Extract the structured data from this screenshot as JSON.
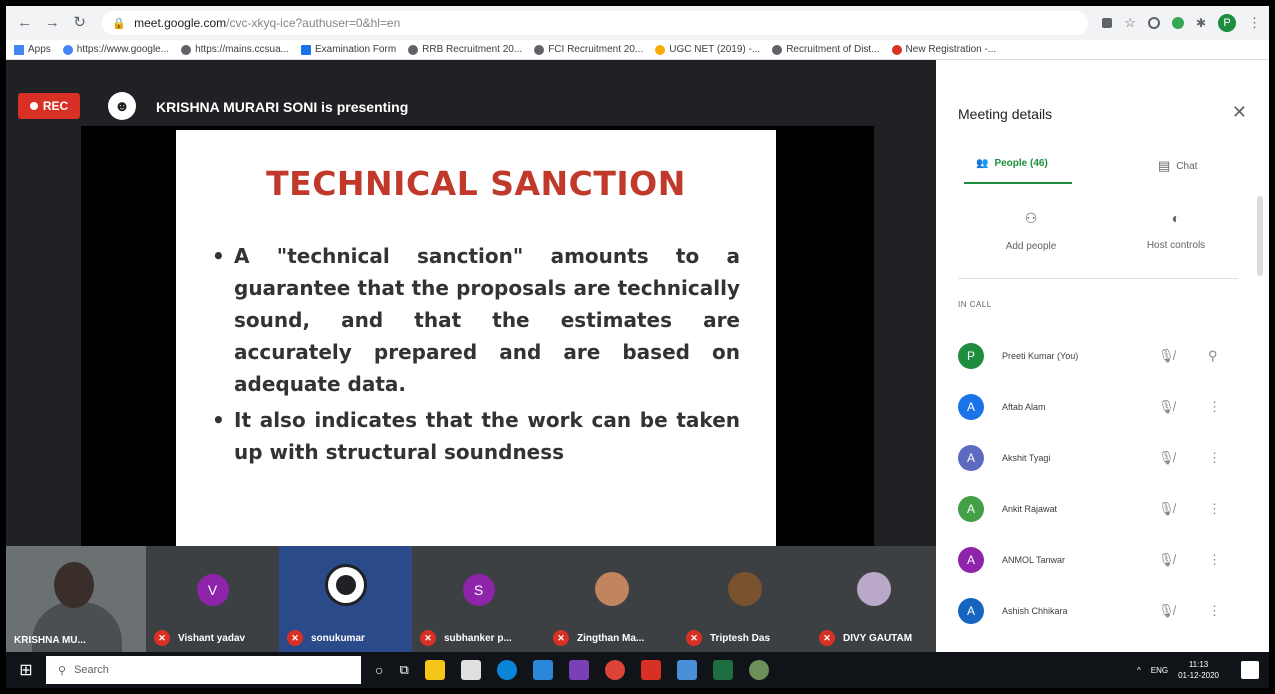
{
  "browser": {
    "url_host": "meet.google.com",
    "url_path": "/cvc-xkyq-ice?authuser=0&hl=en",
    "bookmarks": [
      "Apps",
      "https://www.google...",
      "https://mains.ccsua...",
      "Examination Form",
      "RRB Recruitment 20...",
      "FCI Recruitment 20...",
      "UGC NET (2019) -...",
      "Recruitment of Dist...",
      "New Registration -..."
    ],
    "profile_initial": "P"
  },
  "meet": {
    "rec_label": "REC",
    "presenter_text": "KRISHNA MURARI SONI is presenting",
    "slide": {
      "title": "TECHNICAL SANCTION",
      "bullets": [
        "A \"technical sanction\" amounts to a guarantee that the proposals are technically sound, and that the estimates are accurately prepared and are based on adequate data.",
        "It also indicates that the work can be taken up with structural soundness"
      ]
    },
    "tiles": [
      {
        "name": "KRISHNA MU...",
        "initial": "",
        "color": ""
      },
      {
        "name": "Vishant yadav",
        "initial": "V",
        "color": "#8e24aa"
      },
      {
        "name": "sonukumar",
        "initial": "",
        "color": ""
      },
      {
        "name": "subhanker p...",
        "initial": "S",
        "color": "#8e24aa"
      },
      {
        "name": "Zingthan Ma...",
        "initial": "",
        "color": "#c0855e"
      },
      {
        "name": "Triptesh Das",
        "initial": "",
        "color": "#7a5230"
      },
      {
        "name": "DIVY GAUTAM",
        "initial": "",
        "color": "#b9a8c7"
      }
    ]
  },
  "panel": {
    "title": "Meeting details",
    "tab_people": "People (46)",
    "tab_chat": "Chat",
    "add_people": "Add people",
    "host_controls": "Host controls",
    "in_call_label": "IN CALL",
    "people": [
      {
        "initial": "P",
        "name": "Preeti Kumar (You)",
        "color": "#1e8e3e"
      },
      {
        "initial": "A",
        "name": "Aftab Alam",
        "color": "#1a73e8"
      },
      {
        "initial": "A",
        "name": "Akshit Tyagi",
        "color": "#5c6bc0"
      },
      {
        "initial": "A",
        "name": "Ankit Rajawat",
        "color": "#43a047"
      },
      {
        "initial": "A",
        "name": "ANMOL Tanwar",
        "color": "#8e24aa"
      },
      {
        "initial": "A",
        "name": "Ashish Chhikara",
        "color": "#1565c0"
      }
    ]
  },
  "taskbar": {
    "search_placeholder": "Search",
    "lang": "ENG",
    "time": "11:13",
    "date": "01-12-2020"
  }
}
